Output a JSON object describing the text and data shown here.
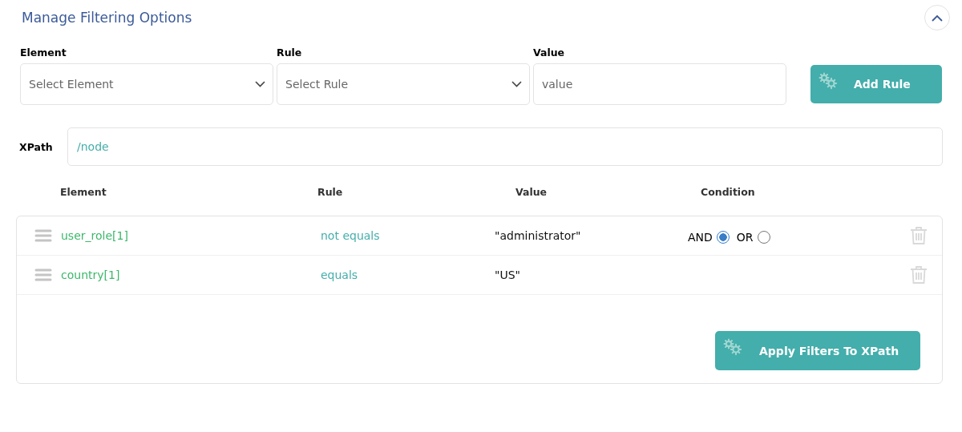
{
  "title": "Manage Filtering Options",
  "form": {
    "fields": [
      {
        "kind": "select",
        "label": "Element",
        "placeholder": "Select Element"
      },
      {
        "kind": "select",
        "label": "Rule",
        "placeholder": "Select Rule"
      },
      {
        "kind": "text",
        "label": "Value",
        "placeholder": "value"
      }
    ],
    "add_button": "Add Rule"
  },
  "xpath": {
    "label": "XPath",
    "value": "/node"
  },
  "table": {
    "columns": [
      "Element",
      "Rule",
      "Value",
      "Condition"
    ],
    "rows": [
      {
        "element": "user_role[1]",
        "rule": "not equals",
        "value": "\"administrator\"",
        "condition": [
          {
            "label": "AND",
            "selected": true
          },
          {
            "label": "OR",
            "selected": false
          }
        ]
      },
      {
        "element": "country[1]",
        "rule": "equals",
        "value": "\"US\""
      }
    ]
  },
  "apply_button": "Apply Filters To XPath"
}
